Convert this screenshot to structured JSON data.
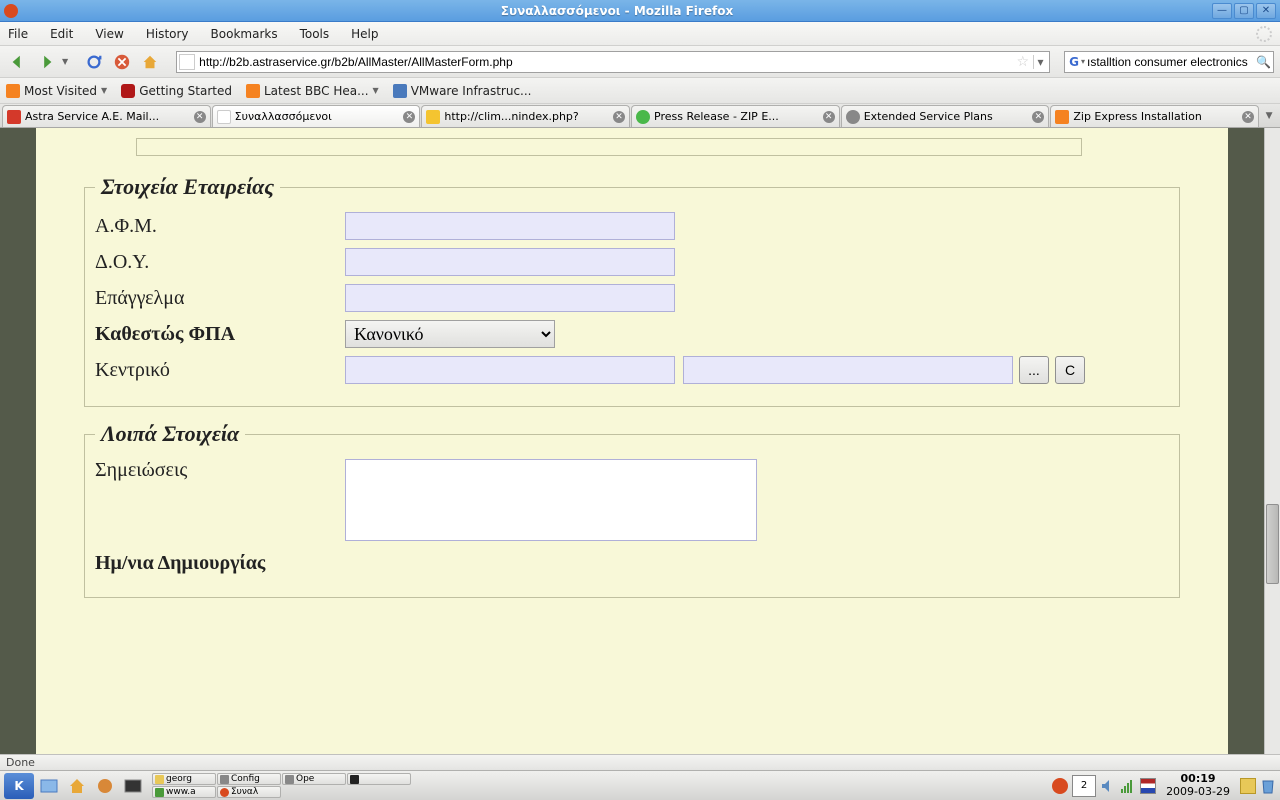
{
  "window": {
    "title": "Συναλλασσόμενοι - Mozilla Firefox"
  },
  "menu": {
    "file": "File",
    "edit": "Edit",
    "view": "View",
    "history": "History",
    "bookmarks": "Bookmarks",
    "tools": "Tools",
    "help": "Help"
  },
  "nav": {
    "url": "http://b2b.astraservice.gr/b2b/AllMaster/AllMasterForm.php",
    "search": "ıstalltion consumer electronics"
  },
  "bookmarks": {
    "mostvisited": "Most Visited",
    "getstarted": "Getting Started",
    "bbc": "Latest BBC Hea...",
    "vmware": "VMware Infrastruc..."
  },
  "tabs": [
    {
      "label": "Astra Service A.E. Mail...",
      "icon": "#d4392a"
    },
    {
      "label": "Συναλλασσόμενοι",
      "icon": "#ffffff"
    },
    {
      "label": "http://clim...nindex.php?",
      "icon": "#f4c430"
    },
    {
      "label": "Press Release - ZIP E...",
      "icon": "#4ab84a"
    },
    {
      "label": "Extended Service Plans",
      "icon": "#888888"
    },
    {
      "label": "Zip Express Installation",
      "icon": "#f58220"
    }
  ],
  "form": {
    "fs1": {
      "legend": "Στοιχεία Εταιρείας",
      "afm": "Α.Φ.Μ.",
      "doy": "Δ.Ο.Υ.",
      "job": "Επάγγελμα",
      "vat": "Καθεστώς ΦΠΑ",
      "vatval": "Κανονικό",
      "central": "Κεντρικό",
      "dots": "...",
      "c": "C"
    },
    "fs2": {
      "legend": "Λοιπά Στοιχεία",
      "notes": "Σημειώσεις",
      "created": "Ημ/νια Δημιουργίας"
    }
  },
  "status": "Done",
  "taskbar": {
    "tasks": [
      [
        "georg",
        "Config",
        "Ope"
      ],
      [
        "www.a",
        "Συναλ",
        ""
      ]
    ],
    "pager": "2",
    "time": "00:19",
    "date": "2009-03-29"
  }
}
